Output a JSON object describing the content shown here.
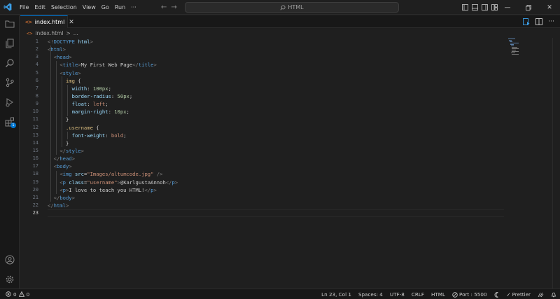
{
  "titlebar": {
    "menu": [
      "File",
      "Edit",
      "Selection",
      "View",
      "Go",
      "Run",
      "···"
    ],
    "search_text": "HTML"
  },
  "tab": {
    "label": "index.html",
    "close": "✕"
  },
  "breadcrumb": {
    "file": "index.html",
    "sep": ">",
    "more": "..."
  },
  "editor": {
    "line_numbers": [
      "1",
      "2",
      "3",
      "4",
      "5",
      "6",
      "7",
      "8",
      "9",
      "10",
      "11",
      "12",
      "13",
      "14",
      "15",
      "16",
      "17",
      "18",
      "19",
      "20",
      "21",
      "22",
      "23"
    ],
    "active_line": 23
  },
  "statusbar": {
    "errors": "0",
    "warnings": "0",
    "position": "Ln 23, Col 1",
    "spaces": "Spaces: 4",
    "encoding": "UTF-8",
    "eol": "CRLF",
    "language": "HTML",
    "port": "Port : 5500",
    "prettier": "Prettier"
  },
  "colors": {
    "accent": "#0078d4",
    "tag": "#569cd6",
    "attribute": "#9cdcfe",
    "string": "#ce9178",
    "selector": "#d7ba7d",
    "number": "#b5cea8"
  },
  "extensions_badge": "1"
}
